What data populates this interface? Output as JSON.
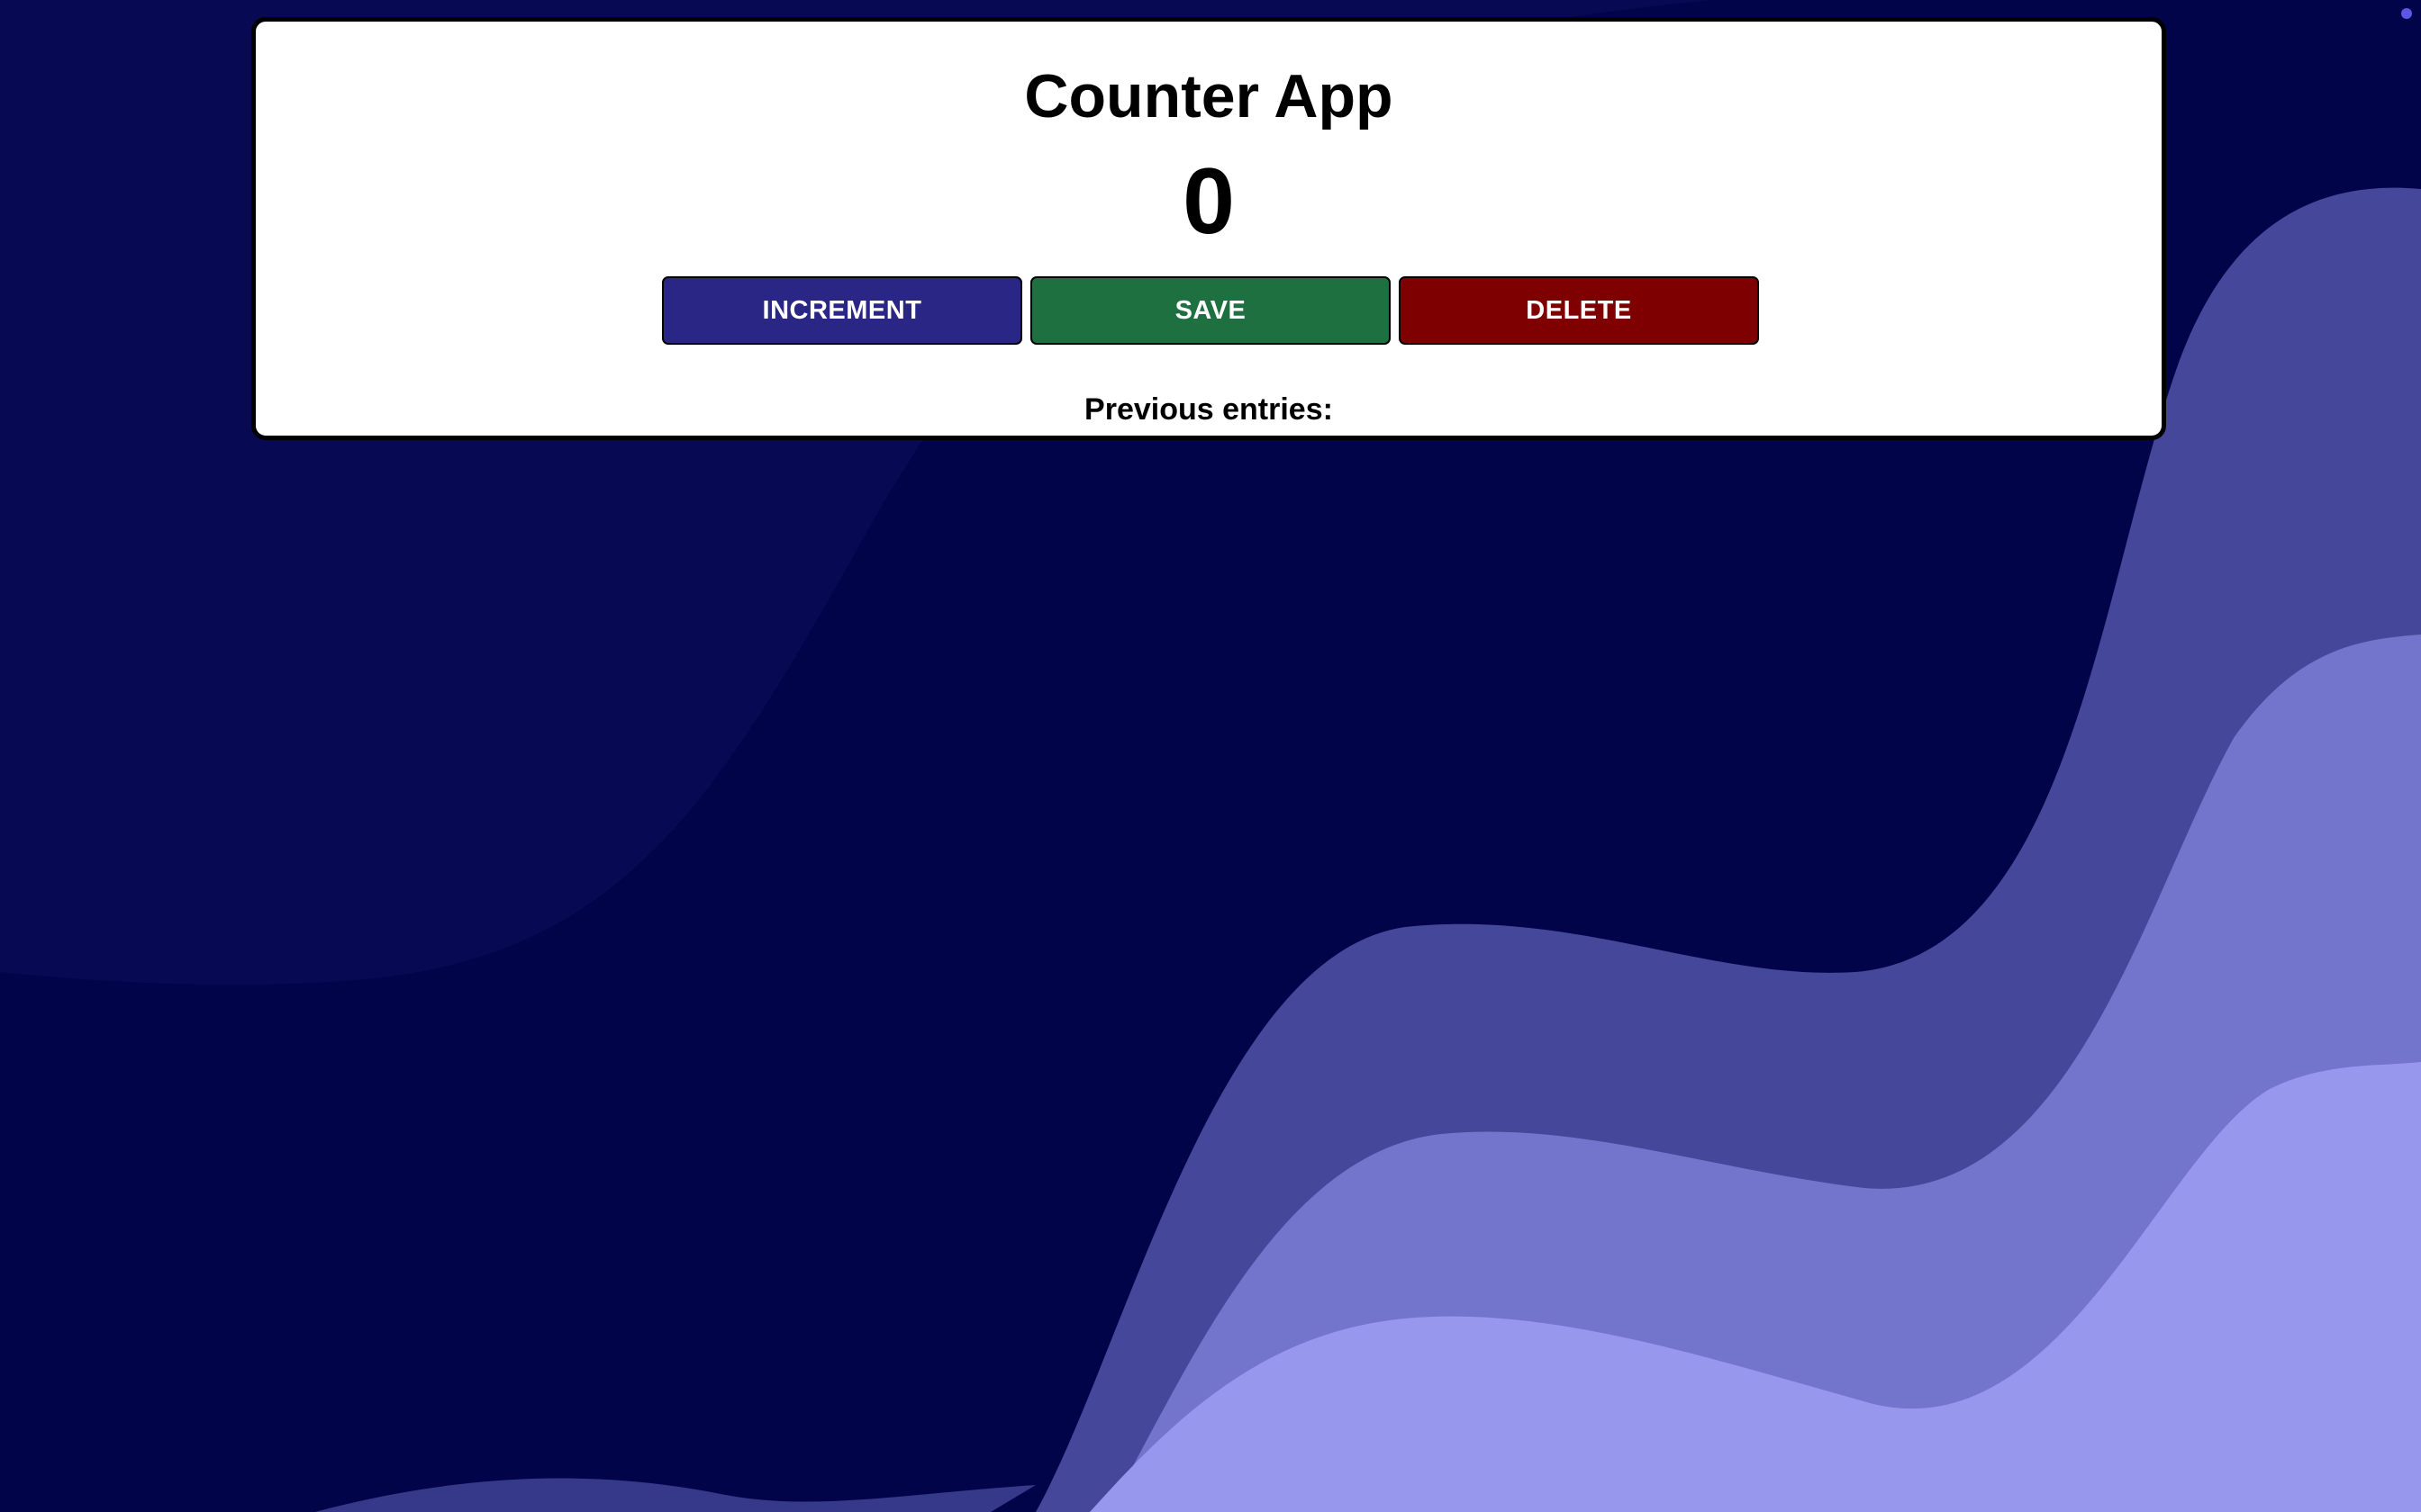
{
  "app": {
    "title": "Counter App",
    "counter_value": "0"
  },
  "buttons": {
    "increment_label": "INCREMENT",
    "save_label": "SAVE",
    "delete_label": "DELETE"
  },
  "entries": {
    "heading": "Previous entries:",
    "items": []
  },
  "colors": {
    "background": "#02044a",
    "wave_1": "#44479a",
    "wave_2": "#7375cc",
    "wave_3": "#9797ee",
    "increment": "#2a2685",
    "save": "#1e7040",
    "delete": "#7f0000",
    "status_dot": "#5b57e6"
  }
}
